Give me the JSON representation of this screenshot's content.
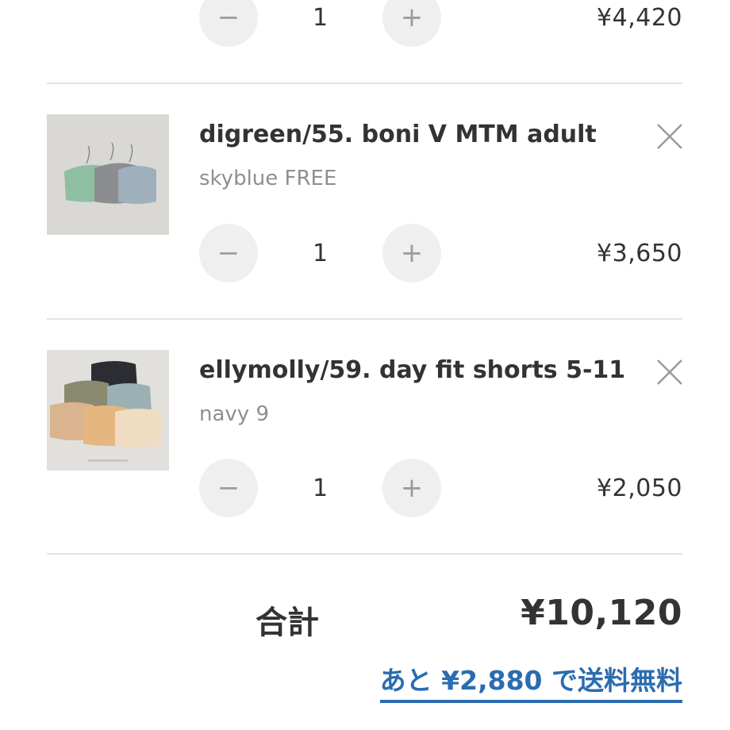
{
  "cart": {
    "items": [
      {
        "quantity": "1",
        "price": "¥4,420"
      },
      {
        "title": "digreen/55. boni V MTM adult",
        "variant": "skyblue FREE",
        "quantity": "1",
        "price": "¥3,650"
      },
      {
        "title": "ellymolly/59. day fit shorts 5-11",
        "variant": "navy 9",
        "quantity": "1",
        "price": "¥2,050"
      }
    ],
    "controls": {
      "decrement_icon": "minus-icon",
      "increment_icon": "plus-icon",
      "remove_icon": "close-icon"
    },
    "total_label": "合計",
    "total_value": "¥10,120",
    "free_shipping_message": "あと ¥2,880 で送料無料"
  },
  "colors": {
    "accent": "#2b6cb0",
    "button_bg": "#efefef",
    "divider": "#e4e4e4",
    "text": "#333333",
    "muted_text": "#8f8f8f"
  }
}
